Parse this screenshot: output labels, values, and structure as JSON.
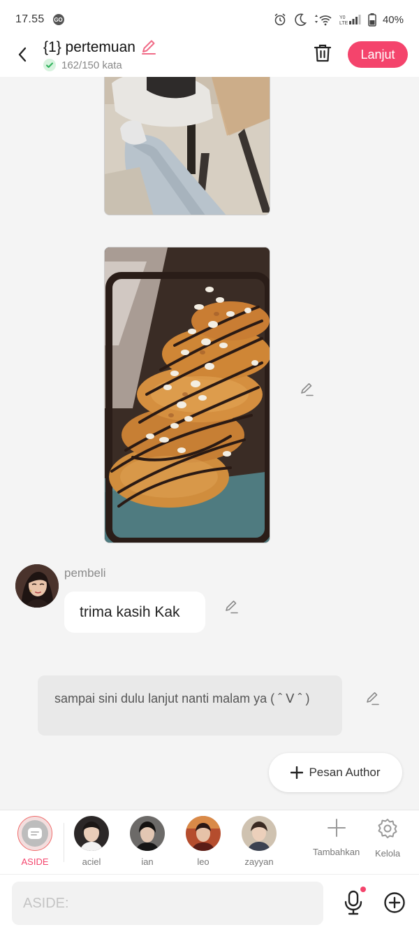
{
  "status_bar": {
    "time": "17.55",
    "app_badge": "GO",
    "battery_percent": "40%",
    "icons": [
      "alarm-icon",
      "moon-icon",
      "wifi-icon",
      "signal-icon",
      "battery-icon"
    ]
  },
  "header": {
    "title": "{1} pertemuan",
    "word_count": "162/150 kata",
    "next_button": "Lanjut"
  },
  "messages": [
    {
      "type": "image",
      "description": "photo-legs-chair"
    },
    {
      "type": "image",
      "description": "photo-bread-chocolate"
    },
    {
      "type": "character",
      "sender": "pembeli",
      "text": "trima kasih Kak"
    },
    {
      "type": "aside",
      "text": "sampai sini dulu lanjut nanti malam ya ( ˆ ᐯ ˆ )"
    }
  ],
  "pesan_author_button": "Pesan Author",
  "characters": [
    {
      "label": "ASIDE",
      "selected": true
    },
    {
      "label": "aciel"
    },
    {
      "label": "ian"
    },
    {
      "label": "leo"
    },
    {
      "label": "zayyan"
    }
  ],
  "tools": {
    "add": "Tambahkan",
    "manage": "Kelola"
  },
  "input": {
    "placeholder": "ASIDE:"
  },
  "colors": {
    "accent": "#f4446c",
    "edit_icon_pink": "#f06b87",
    "check_green": "#2fb35c"
  }
}
